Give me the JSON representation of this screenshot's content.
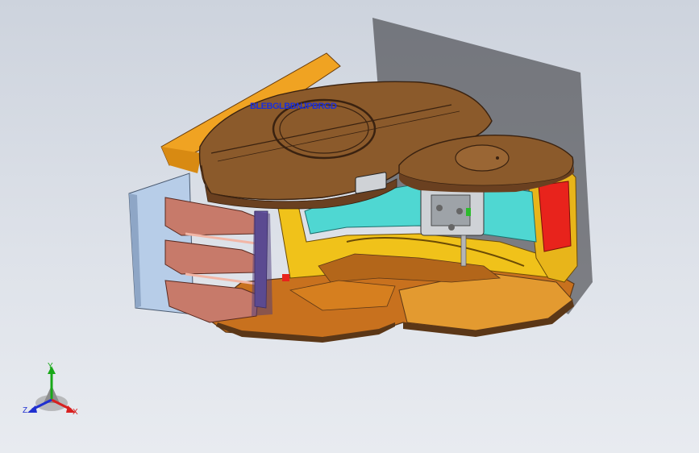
{
  "viewport": {
    "model_annotation": "BLEBGLBBNJPBRGD",
    "colors": {
      "background_top": "#cdd3dd",
      "background_bottom": "#e8ebf0",
      "top_shell": "#8b5a2b",
      "shell_dark": "#5b3717",
      "orange": "#f0a322",
      "yellow": "#f0c21a",
      "cyan": "#4fd7d2",
      "red": "#e8231c",
      "salmon": "#c77a6a",
      "light_blue": "#b7cde8",
      "annotation_blue": "#1b2fd8"
    }
  },
  "triad": {
    "y_label": "Y",
    "x_label": "X",
    "z_label": "Z",
    "y_color": "#18a818",
    "x_color": "#d82020",
    "z_color": "#2030d0"
  }
}
